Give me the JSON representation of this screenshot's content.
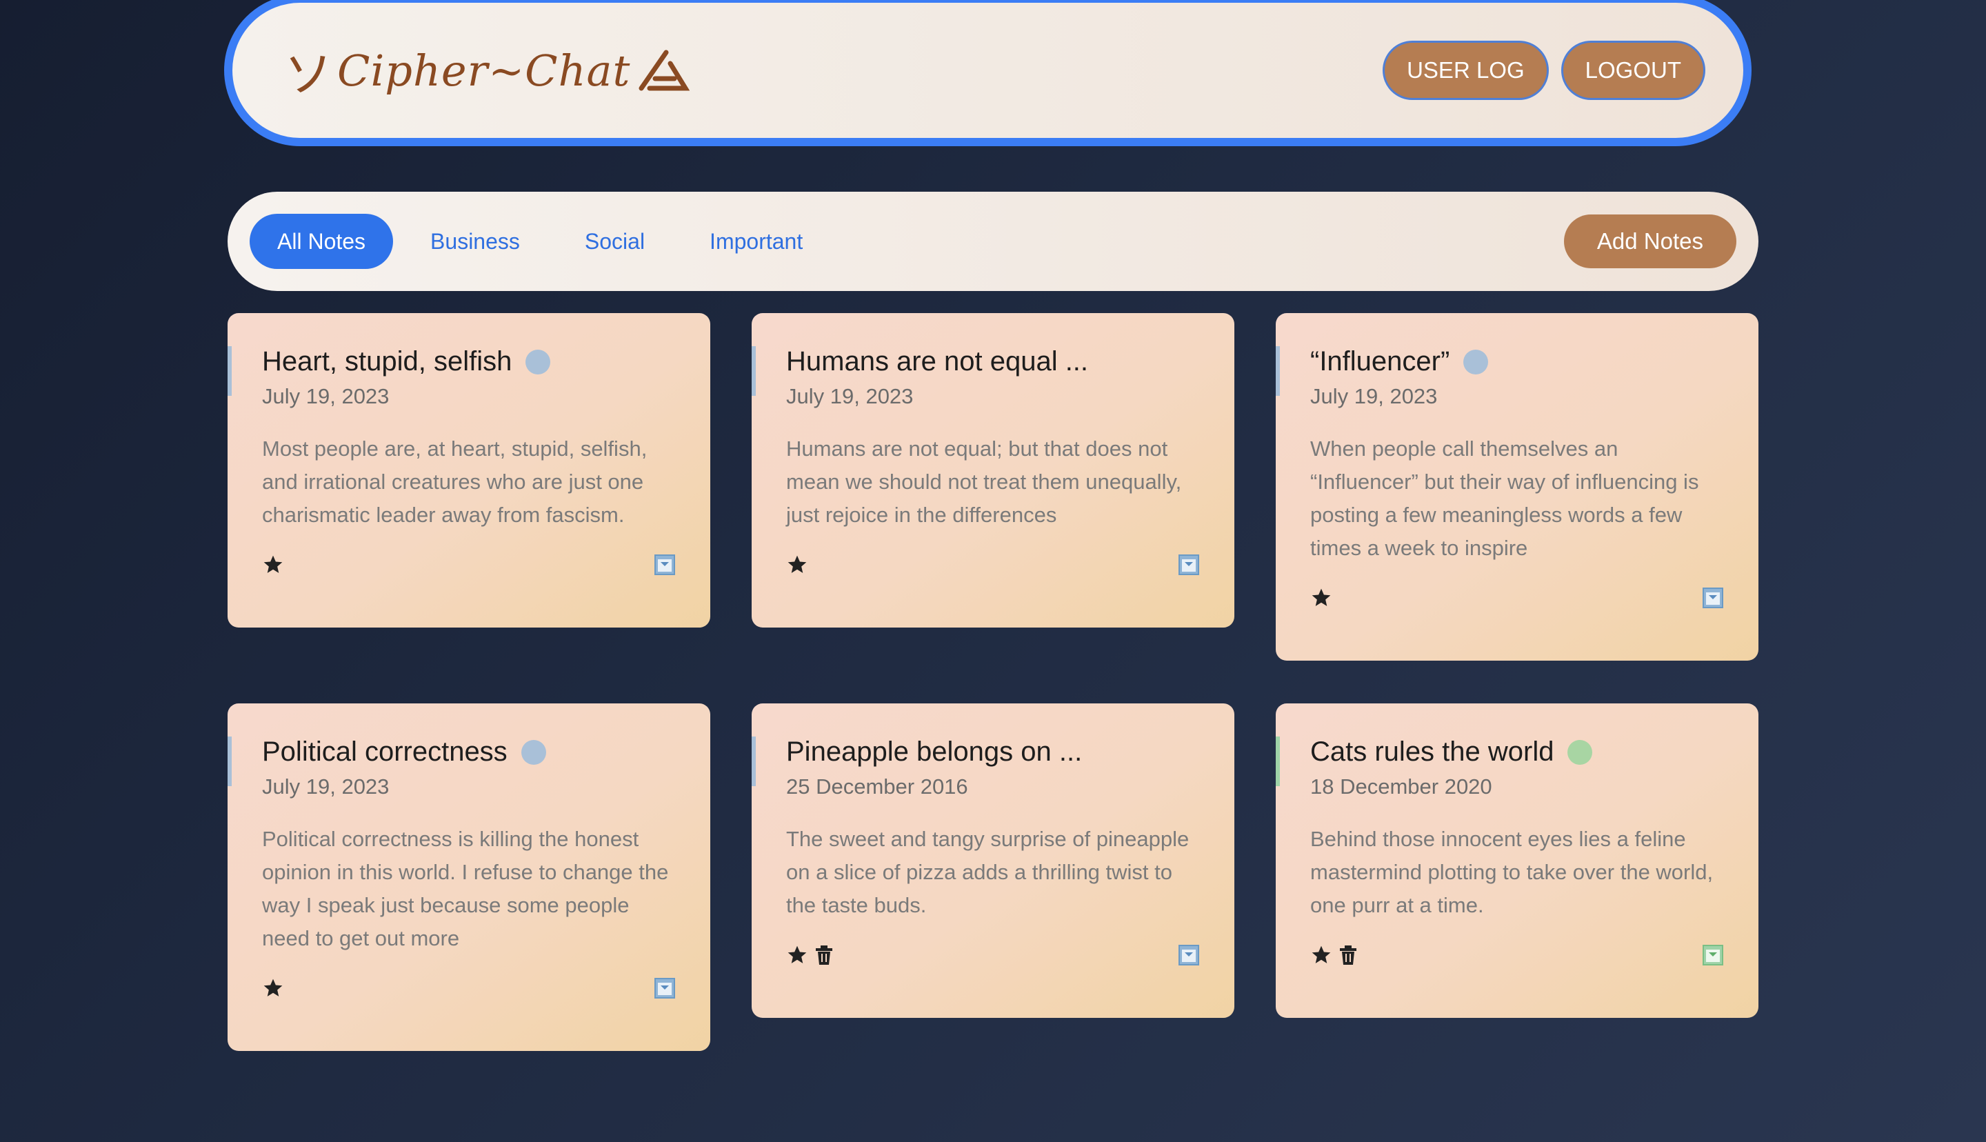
{
  "header": {
    "logo_text": "Cipher~Chat",
    "user_log_label": "USER LOG",
    "logout_label": "LOGOUT"
  },
  "toolbar": {
    "tabs": [
      {
        "label": "All Notes",
        "active": true
      },
      {
        "label": "Business",
        "active": false
      },
      {
        "label": "Social",
        "active": false
      },
      {
        "label": "Important",
        "active": false
      }
    ],
    "add_label": "Add Notes"
  },
  "notes": [
    {
      "title": "Heart, stupid, selfish",
      "date": "July 19, 2023",
      "body": "Most people are, at heart, stupid, selfish, and irrational creatures who are just one charismatic leader away from fascism.",
      "tag_color": "#a9c0d8",
      "starred": true,
      "deletable": false
    },
    {
      "title": "Humans are not equal ...",
      "date": "July 19, 2023",
      "body": "Humans are not equal; but that does not mean we should not treat them unequally, just rejoice in the differences",
      "tag_color": "#a9c0d8",
      "starred": true,
      "deletable": false
    },
    {
      "title": "“Influencer”",
      "date": "July 19, 2023",
      "body": "When people call themselves an “Influencer” but their way of influencing is posting a few meaningless words a few times a week to inspire",
      "tag_color": "#a9c0d8",
      "starred": true,
      "deletable": false
    },
    {
      "title": "Political correctness",
      "date": "July 19, 2023",
      "body": "Political correctness is killing the honest opinion in this world. I refuse to change the way I speak just because some people need to get out more",
      "tag_color": "#a9c0d8",
      "starred": true,
      "deletable": false
    },
    {
      "title": "Pineapple belongs on ...",
      "date": "25 December 2016",
      "body": "The sweet and tangy surprise of pineapple on a slice of pizza adds a thrilling twist to the taste buds.",
      "tag_color": "#a9c0d8",
      "starred": true,
      "deletable": true
    },
    {
      "title": "Cats rules the world",
      "date": "18 December 2020",
      "body": "Behind those innocent eyes lies a feline mastermind plotting to take over the world, one purr at a time.",
      "tag_color": "#a8d5a3",
      "starred": true,
      "deletable": true
    }
  ]
}
